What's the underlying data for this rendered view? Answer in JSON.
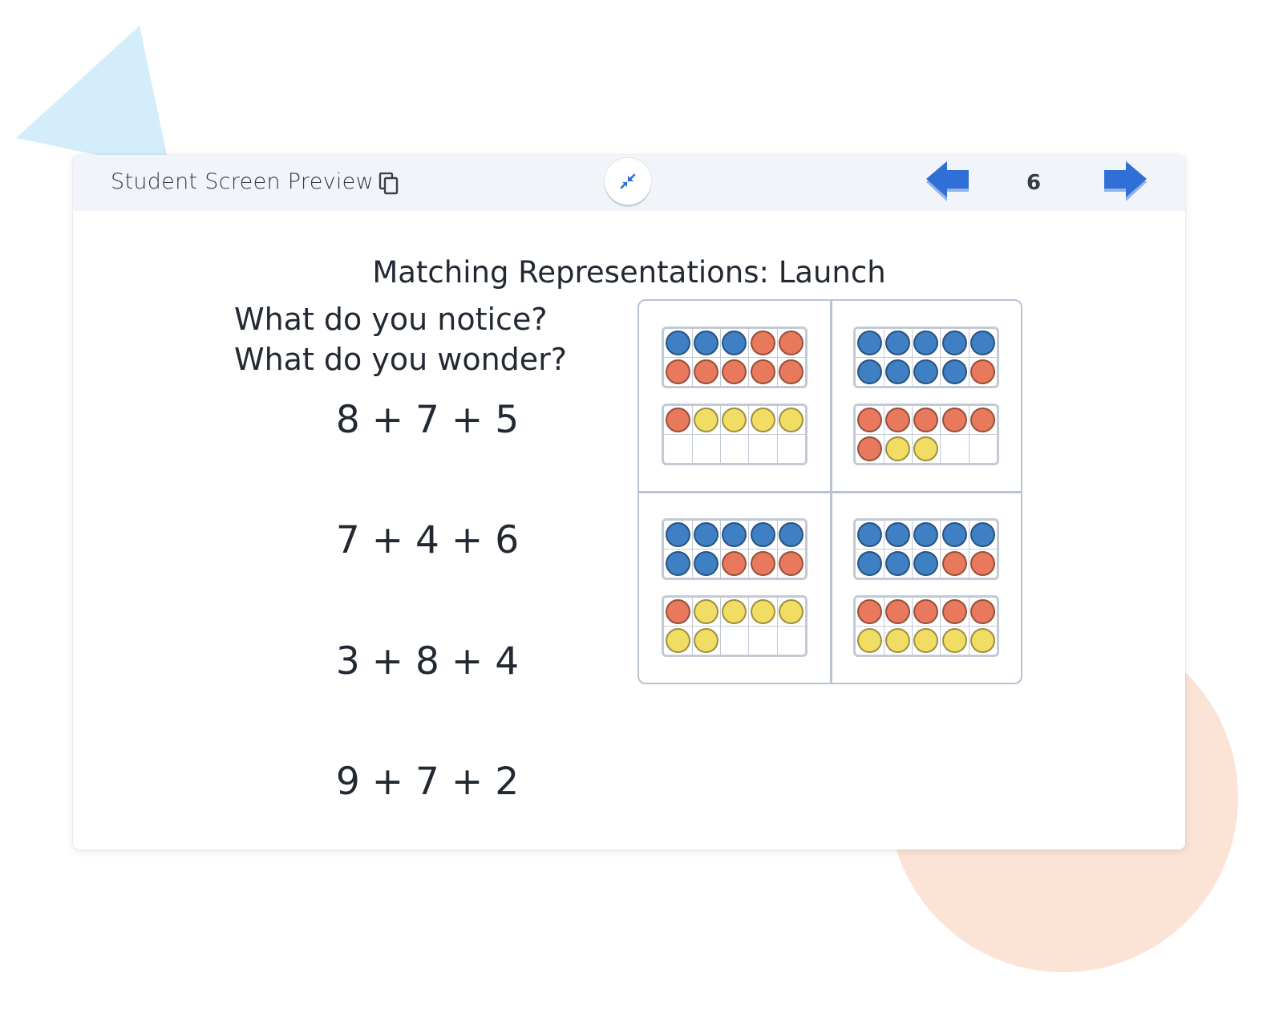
{
  "header": {
    "title": "Student Screen Preview",
    "copy_icon": "copy-icon",
    "collapse_icon": "collapse-arrows-icon",
    "prev_icon": "arrow-left-icon",
    "next_icon": "arrow-right-icon",
    "page_number": "6"
  },
  "slide": {
    "title": "Matching Representations: Launch",
    "prompt_line1": "What do you notice?",
    "prompt_line2": "What do you wonder?",
    "expressions": [
      "8 + 7 + 5",
      "7 + 4 + 6",
      "3 + 8 + 4",
      "9 + 7 + 2"
    ]
  },
  "colors": {
    "blue": "#3f7fc4",
    "orange": "#e9795c",
    "yellow": "#f1dc64",
    "accent": "#2f6fd6",
    "deco_triangle": "#d3eefa",
    "deco_circle": "#fbe3d5"
  },
  "ten_frames": [
    [
      [
        "B",
        "B",
        "B",
        "O",
        "O",
        "O",
        "O",
        "O",
        "O",
        "O"
      ],
      [
        "O",
        "Y",
        "Y",
        "Y",
        "Y",
        "",
        "",
        "",
        "",
        ""
      ]
    ],
    [
      [
        "B",
        "B",
        "B",
        "B",
        "B",
        "B",
        "B",
        "B",
        "B",
        "O"
      ],
      [
        "O",
        "O",
        "O",
        "O",
        "O",
        "O",
        "Y",
        "Y",
        "",
        ""
      ]
    ],
    [
      [
        "B",
        "B",
        "B",
        "B",
        "B",
        "B",
        "B",
        "O",
        "O",
        "O"
      ],
      [
        "O",
        "Y",
        "Y",
        "Y",
        "Y",
        "Y",
        "Y",
        "",
        "",
        ""
      ]
    ],
    [
      [
        "B",
        "B",
        "B",
        "B",
        "B",
        "B",
        "B",
        "B",
        "O",
        "O"
      ],
      [
        "O",
        "O",
        "O",
        "O",
        "O",
        "Y",
        "Y",
        "Y",
        "Y",
        "Y"
      ]
    ]
  ]
}
